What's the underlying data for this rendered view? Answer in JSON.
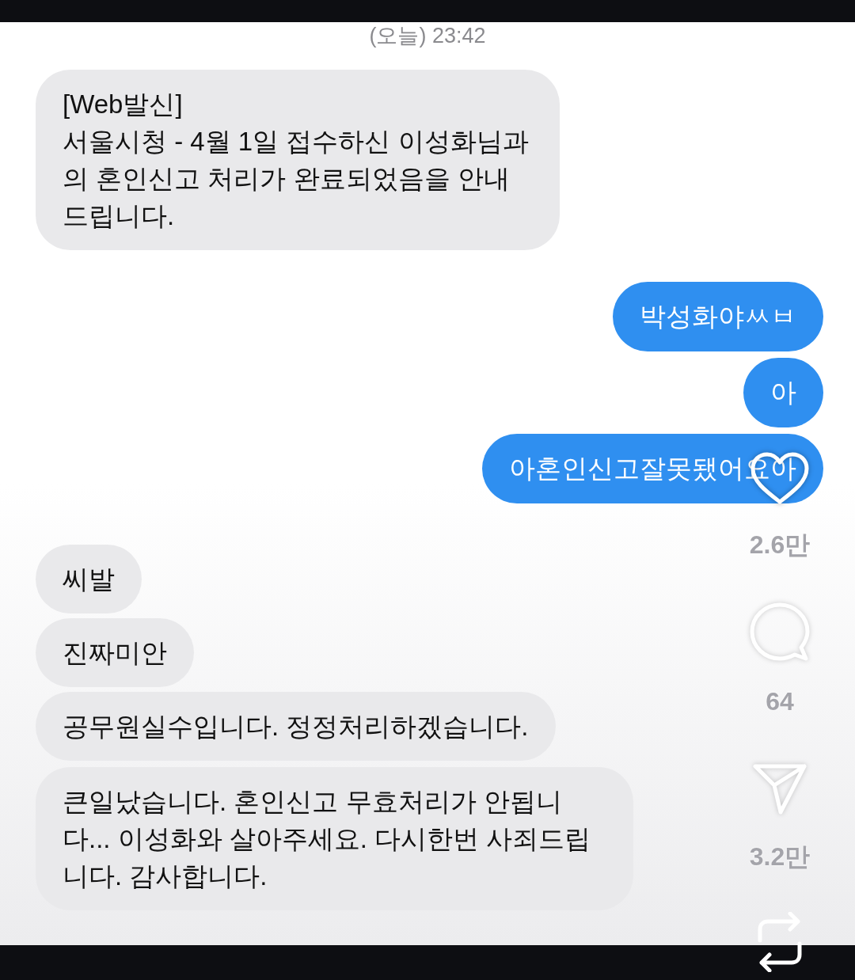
{
  "timestamp": "(오늘) 23:42",
  "messages": [
    {
      "sent": false,
      "text": "[Web발신]\n서울시청 - 4월 1일 접수하신 이성화님과의 혼인신고 처리가 완료되었음을 안내드립니다."
    },
    {
      "sent": true,
      "text": "박성화야ㅆㅂ"
    },
    {
      "sent": true,
      "text": "아"
    },
    {
      "sent": true,
      "text": "아혼인신고잘못됐어요아"
    },
    {
      "sent": false,
      "text": "씨발"
    },
    {
      "sent": false,
      "text": "진짜미안"
    },
    {
      "sent": false,
      "text": "공무원실수입니다. 정정처리하겠습니다."
    },
    {
      "sent": false,
      "text": "큰일났습니다. 혼인신고 무효처리가 안됩니다... 이성화와 살아주세요. 다시한번 사죄드립니다. 감사합니다."
    }
  ],
  "reel_actions": [
    {
      "kind": "like",
      "count": "2.6만"
    },
    {
      "kind": "comment",
      "count": "64"
    },
    {
      "kind": "share",
      "count": "3.2만"
    },
    {
      "kind": "repost"
    }
  ]
}
